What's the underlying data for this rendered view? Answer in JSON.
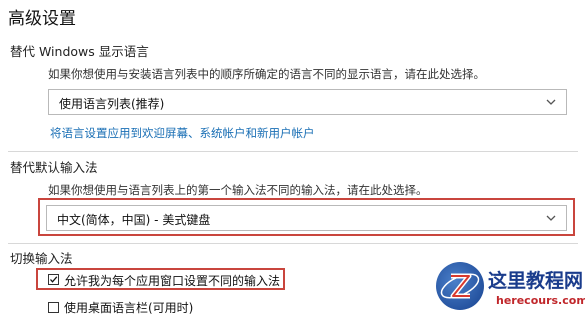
{
  "page_title": "高级设置",
  "display_language": {
    "title": "替代 Windows 显示语言",
    "description": "如果你想使用与安装语言列表中的顺序所确定的语言不同的显示语言，请在此处选择。",
    "selected": "使用语言列表(推荐)",
    "link": "将语言设置应用到欢迎屏幕、系统帐户和新用户帐户"
  },
  "input_method": {
    "title": "替代默认输入法",
    "description": "如果你想使用与语言列表上的第一个输入法不同的输入法，请在此处选择。",
    "selected": "中文(简体，中国) - 美式键盘"
  },
  "switch_input": {
    "title": "切换输入法",
    "options": [
      {
        "label": "允许我为每个应用窗口设置不同的输入法",
        "checked": true
      },
      {
        "label": "使用桌面语言栏(可用时)",
        "checked": false
      }
    ]
  },
  "watermark": {
    "title": "这里教程网",
    "subtitle": "herecours.com",
    "logo_letter": "Z"
  },
  "colors": {
    "highlight_border": "#c9453d",
    "link": "#1a6fb5"
  }
}
